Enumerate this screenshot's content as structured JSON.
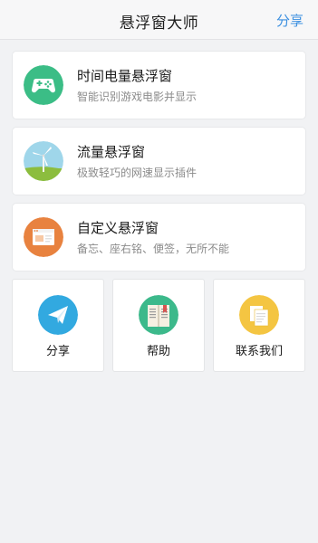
{
  "header": {
    "title": "悬浮窗大师",
    "share_label": "分享"
  },
  "cards": [
    {
      "title": "时间电量悬浮窗",
      "desc": "智能识别游戏电影并显示",
      "icon": "gamepad-icon",
      "color": "#3bbd86"
    },
    {
      "title": "流量悬浮窗",
      "desc": "极致轻巧的网速显示插件",
      "icon": "windmill-icon",
      "color": "#8ed0e6"
    },
    {
      "title": "自定义悬浮窗",
      "desc": "备忘、座右铭、便签，无所不能",
      "icon": "browser-window-icon",
      "color": "#e8823f"
    }
  ],
  "tiles": [
    {
      "label": "分享",
      "icon": "paper-plane-icon",
      "color": "#32a9e0"
    },
    {
      "label": "帮助",
      "icon": "book-icon",
      "color": "#3cb98b"
    },
    {
      "label": "联系我们",
      "icon": "documents-icon",
      "color": "#f4c542"
    }
  ]
}
